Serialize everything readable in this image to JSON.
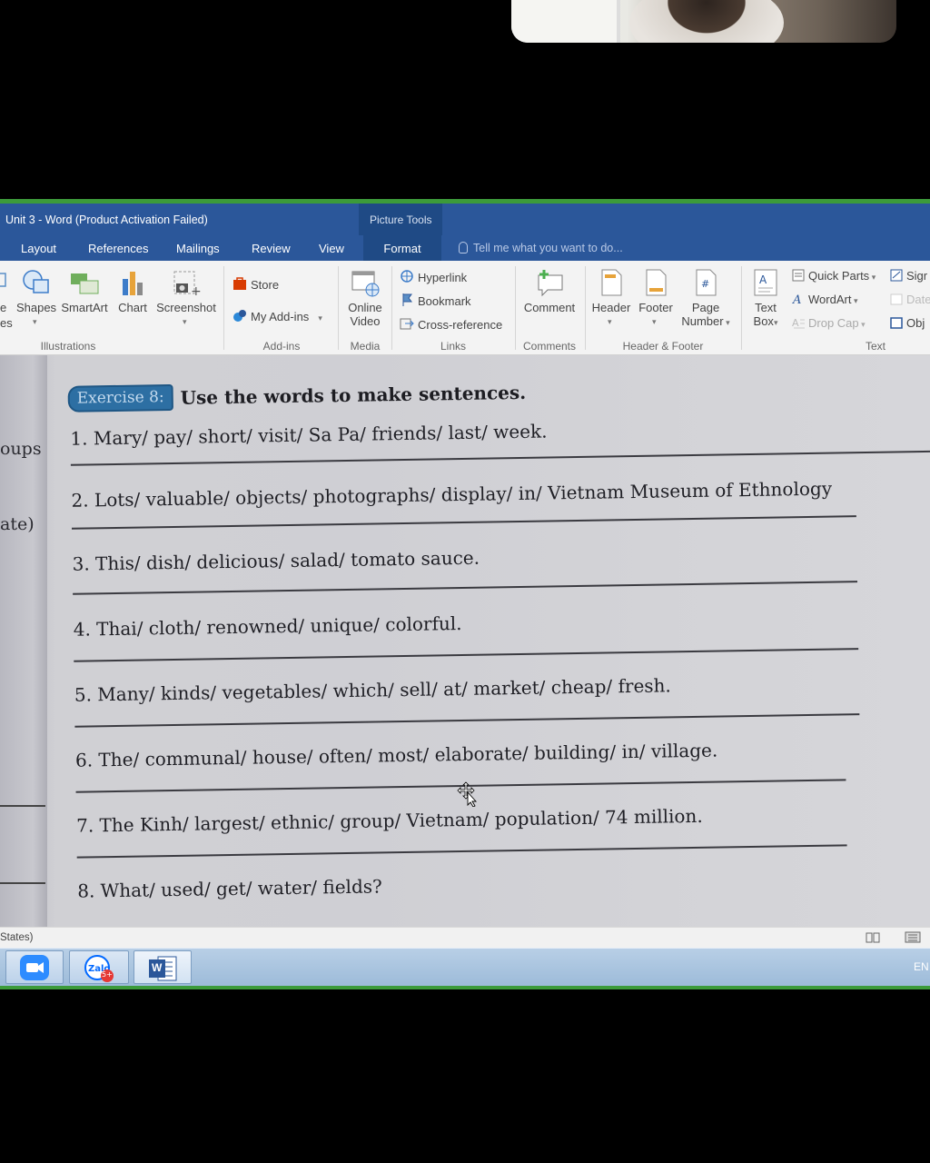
{
  "window_title": "Unit 3 - Word (Product Activation Failed)",
  "contextual_tab_group": "Picture Tools",
  "tabs": [
    "Layout",
    "References",
    "Mailings",
    "Review",
    "View"
  ],
  "active_tab": "Format",
  "tell_me_placeholder": "Tell me what you want to do...",
  "ribbon": {
    "cut_left_labels": [
      "e",
      "es"
    ],
    "illustrations": {
      "shapes": "Shapes",
      "smartart": "SmartArt",
      "chart": "Chart",
      "screenshot": "Screenshot",
      "group": "Illustrations"
    },
    "addins": {
      "store": "Store",
      "my_addins": "My Add-ins",
      "group": "Add-ins"
    },
    "media": {
      "online_video_1": "Online",
      "online_video_2": "Video",
      "group": "Media"
    },
    "links": {
      "hyperlink": "Hyperlink",
      "bookmark": "Bookmark",
      "cross_reference": "Cross-reference",
      "group": "Links"
    },
    "comments": {
      "comment": "Comment",
      "group": "Comments"
    },
    "header_footer": {
      "header": "Header",
      "footer": "Footer",
      "page_number_1": "Page",
      "page_number_2": "Number",
      "group": "Header & Footer"
    },
    "text": {
      "text_box_1": "Text",
      "text_box_2": "Box",
      "quick_parts": "Quick Parts",
      "wordart": "WordArt",
      "drop_cap": "Drop Cap",
      "signature": "Sigr",
      "date": "Date",
      "object": "Obj",
      "group": "Text"
    }
  },
  "document": {
    "margin_texts": [
      "oups",
      "ate)"
    ],
    "exercise_badge": "Exercise 8:",
    "exercise_title": "Use the words to make sentences.",
    "sentences": [
      "1. Mary/ pay/ short/ visit/ Sa Pa/ friends/ last/ week.",
      "2. Lots/ valuable/ objects/ photographs/ display/ in/ Vietnam Museum of Ethnology",
      "3. This/ dish/ delicious/ salad/ tomato sauce.",
      "4. Thai/ cloth/ renowned/ unique/ colorful.",
      "5. Many/ kinds/ vegetables/ which/ sell/ at/ market/ cheap/ fresh.",
      "6. The/ communal/ house/ often/ most/ elaborate/ building/ in/ village.",
      "7. The Kinh/ largest/ ethnic/ group/ Vietnam/ population/ 74 million.",
      "8. What/ used/ get/ water/ fields?"
    ]
  },
  "status_bar": {
    "language": "States)"
  },
  "taskbar": {
    "apps": [
      "zoom-icon",
      "zalo-icon",
      "word-icon"
    ],
    "zalo_badge": "5+",
    "word_letter": "W",
    "language": "EN"
  },
  "colors": {
    "title_bar": "#2b579a",
    "active_tab": "#1f4a85",
    "accent_green": "#3c9b3a",
    "exercise_badge": "#2d6fa3"
  }
}
